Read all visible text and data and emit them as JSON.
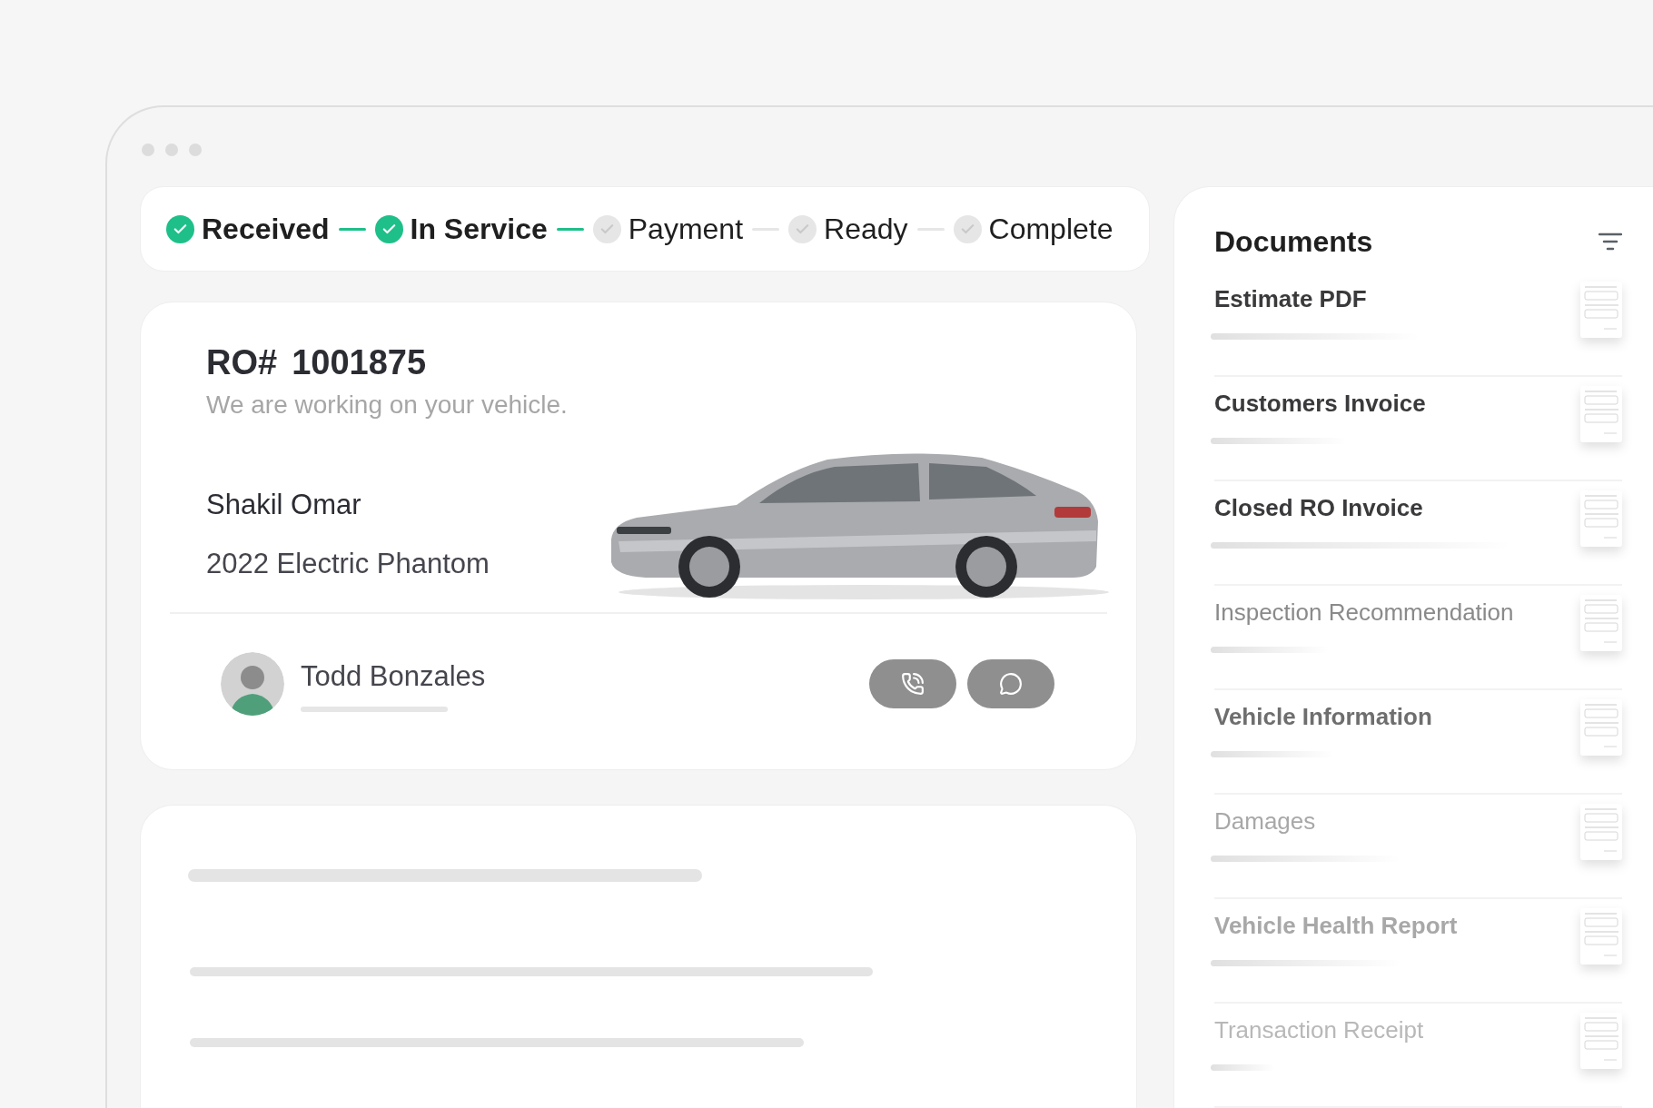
{
  "status_steps": [
    {
      "label": "Received",
      "done": true
    },
    {
      "label": "In Service",
      "done": true
    },
    {
      "label": "Payment",
      "done": false
    },
    {
      "label": "Ready",
      "done": false
    },
    {
      "label": "Complete",
      "done": false
    }
  ],
  "repair_order": {
    "number_label": "RO#",
    "number": "1001875",
    "message": "We are working on your vehicle.",
    "customer": "Shakil Omar",
    "vehicle": "2022 Electric Phantom"
  },
  "advisor": {
    "name": "Todd Bonzales"
  },
  "documents": {
    "title": "Documents",
    "items": [
      {
        "name": "Estimate PDF",
        "bold": true,
        "color": "#3a3a3c"
      },
      {
        "name": "Customers Invoice",
        "bold": true,
        "color": "#3a3a3c"
      },
      {
        "name": "Closed RO Invoice",
        "bold": true,
        "color": "#3a3a3c"
      },
      {
        "name": "Inspection Recommendation",
        "bold": false,
        "color": "#8a8a8a"
      },
      {
        "name": "Vehicle Information",
        "bold": true,
        "color": "#6e6e6e"
      },
      {
        "name": "Damages",
        "bold": false,
        "color": "#a8a8a8"
      },
      {
        "name": "Vehicle Health Report",
        "bold": true,
        "color": "#a8a8a8"
      },
      {
        "name": "Transaction Receipt",
        "bold": false,
        "color": "#b8b8b8"
      }
    ]
  }
}
